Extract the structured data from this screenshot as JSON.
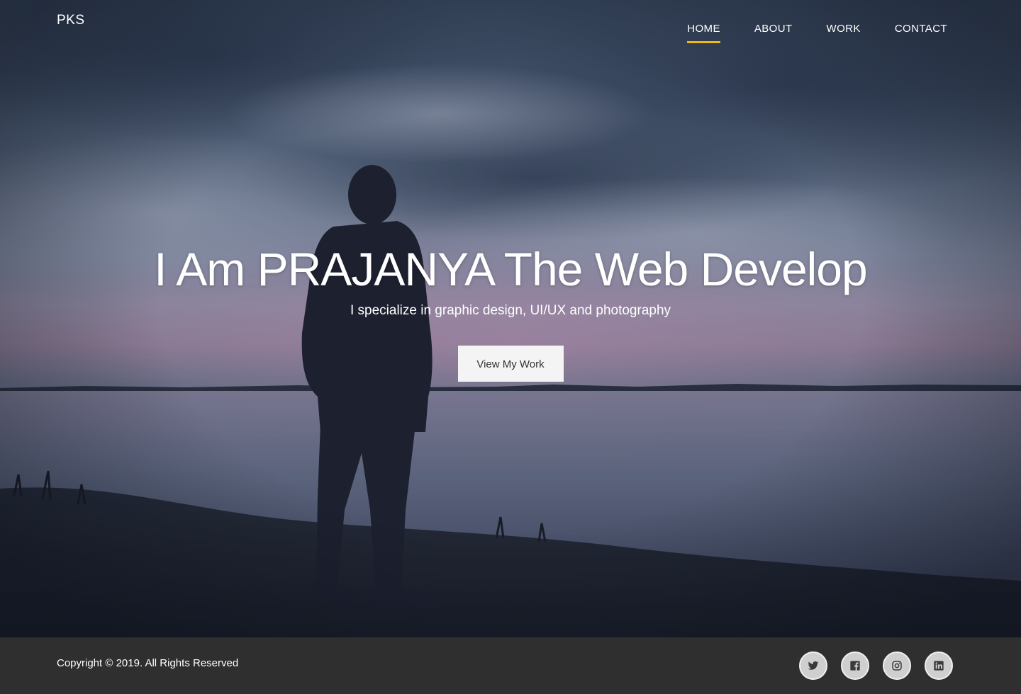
{
  "header": {
    "logo": "PKS",
    "nav": [
      {
        "label": "HOME",
        "active": true
      },
      {
        "label": "ABOUT",
        "active": false
      },
      {
        "label": "WORK",
        "active": false
      },
      {
        "label": "CONTACT",
        "active": false
      }
    ]
  },
  "hero": {
    "title": "I Am PRAJANYA The Web Develop",
    "subtitle": "I specialize in graphic design, UI/UX and photography",
    "cta_label": "View My Work"
  },
  "footer": {
    "copyright": "Copyright © 2019. All Rights Reserved",
    "socials": [
      {
        "name": "twitter-icon"
      },
      {
        "name": "facebook-icon"
      },
      {
        "name": "instagram-icon"
      },
      {
        "name": "linkedin-icon"
      }
    ]
  },
  "colors": {
    "accent": "#f0b90b",
    "footer_bg": "#2f2f2f",
    "button_bg": "#f4f4f4"
  }
}
